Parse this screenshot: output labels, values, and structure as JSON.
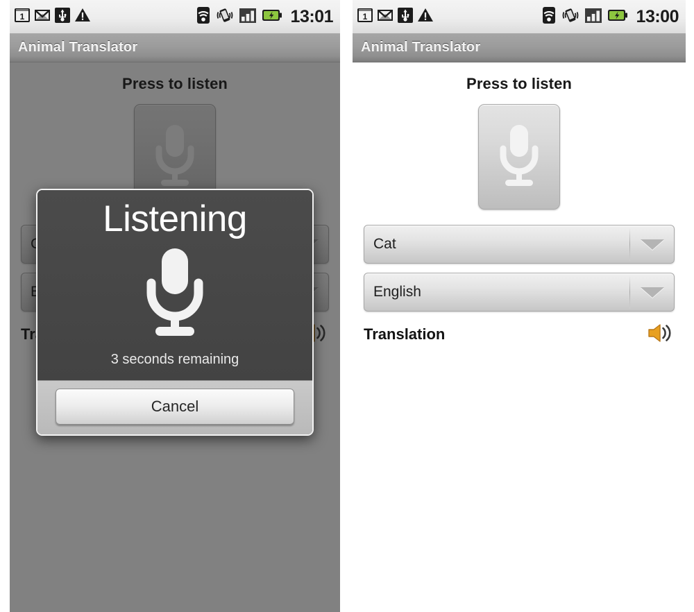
{
  "panels": [
    {
      "id": "left",
      "status_bar": {
        "time": "13:01",
        "left_icons": [
          "calendar-icon",
          "gmail-icon",
          "usb-icon",
          "warning-icon"
        ],
        "right_icons": [
          "wifi-icon",
          "vibrate-icon",
          "signal-bars-icon",
          "battery-charging-icon"
        ],
        "calendar_day": "1"
      },
      "title_bar": {
        "title": "Animal Translator"
      },
      "content": {
        "press_label": "Press to listen",
        "mic_button_name": "microphone-button",
        "source_spinner": "Cat",
        "target_spinner": "English",
        "translation_label": "Translation",
        "speaker_icon": "speaker-icon"
      },
      "dialog": {
        "visible": true,
        "title": "Listening",
        "icon": "microphone-icon",
        "subtitle": "3 seconds remaining",
        "cancel_label": "Cancel"
      }
    },
    {
      "id": "right",
      "status_bar": {
        "time": "13:00",
        "left_icons": [
          "calendar-icon",
          "gmail-icon",
          "usb-icon",
          "warning-icon"
        ],
        "right_icons": [
          "wifi-icon",
          "vibrate-icon",
          "signal-bars-icon",
          "battery-charging-icon"
        ],
        "calendar_day": "1"
      },
      "title_bar": {
        "title": "Animal Translator"
      },
      "content": {
        "press_label": "Press to listen",
        "mic_button_name": "microphone-button",
        "source_spinner": "Cat",
        "target_spinner": "English",
        "translation_label": "Translation",
        "speaker_icon": "speaker-icon"
      },
      "dialog": {
        "visible": false
      }
    }
  ],
  "colors": {
    "title_bar": "#9c9c9c",
    "status_bar": "#ededed",
    "speaker_accent": "#e8a020",
    "battery_green": "#8dc63f",
    "dialog_bg": "#474747",
    "text_dark": "#171717"
  }
}
